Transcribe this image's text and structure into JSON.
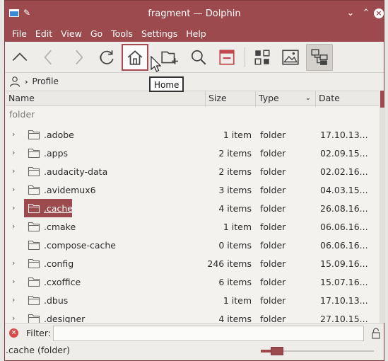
{
  "window": {
    "title": "fragment — Dolphin"
  },
  "menu": [
    "File",
    "Edit",
    "View",
    "Go",
    "Tools",
    "Settings",
    "Help"
  ],
  "toolbar": {
    "tooltip": "Home",
    "buttons": [
      "up-icon",
      "back-icon",
      "forward-icon",
      "reload-icon",
      "home-icon",
      "new-folder-icon",
      "search-icon",
      "preview-panel-icon",
      "icons-view-icon",
      "preview-view-icon",
      "split-view-icon"
    ]
  },
  "breadcrumb": {
    "items": [
      "Profile"
    ]
  },
  "columns": {
    "name": "Name",
    "size": "Size",
    "type": "Type",
    "date": "Date"
  },
  "group_label": "folder",
  "rows": [
    {
      "name": ".adobe",
      "size": "1 item",
      "type": "folder",
      "date": "17.10.13...",
      "expandable": true,
      "selected": false
    },
    {
      "name": ".apps",
      "size": "2 items",
      "type": "folder",
      "date": "02.09.15...",
      "expandable": true,
      "selected": false
    },
    {
      "name": ".audacity-data",
      "size": "2 items",
      "type": "folder",
      "date": "02.02.16...",
      "expandable": true,
      "selected": false
    },
    {
      "name": ".avidemux6",
      "size": "3 items",
      "type": "folder",
      "date": "04.03.15...",
      "expandable": true,
      "selected": false
    },
    {
      "name": ".cache",
      "size": "4 items",
      "type": "folder",
      "date": "26.08.16...",
      "expandable": true,
      "selected": true
    },
    {
      "name": ".cmake",
      "size": "1 item",
      "type": "folder",
      "date": "06.06.16...",
      "expandable": true,
      "selected": false
    },
    {
      "name": ".compose-cache",
      "size": "0 items",
      "type": "folder",
      "date": "06.06.16...",
      "expandable": false,
      "selected": false
    },
    {
      "name": ".config",
      "size": "246 items",
      "type": "folder",
      "date": "15.09.16...",
      "expandable": true,
      "selected": false
    },
    {
      "name": ".cxoffice",
      "size": "6 items",
      "type": "folder",
      "date": "15.07.16...",
      "expandable": true,
      "selected": false
    },
    {
      "name": ".dbus",
      "size": "1 item",
      "type": "folder",
      "date": "17.10.13...",
      "expandable": true,
      "selected": false
    },
    {
      "name": ".designer",
      "size": "4 items",
      "type": "folder",
      "date": "27.10.15...",
      "expandable": true,
      "selected": false
    }
  ],
  "filter": {
    "label": "Filter:",
    "value": "",
    "placeholder": ""
  },
  "status": {
    "text": ".cache (folder)",
    "zoom_fraction": 0.1
  },
  "colors": {
    "accent": "#9c4a4e",
    "background": "#efedea"
  }
}
